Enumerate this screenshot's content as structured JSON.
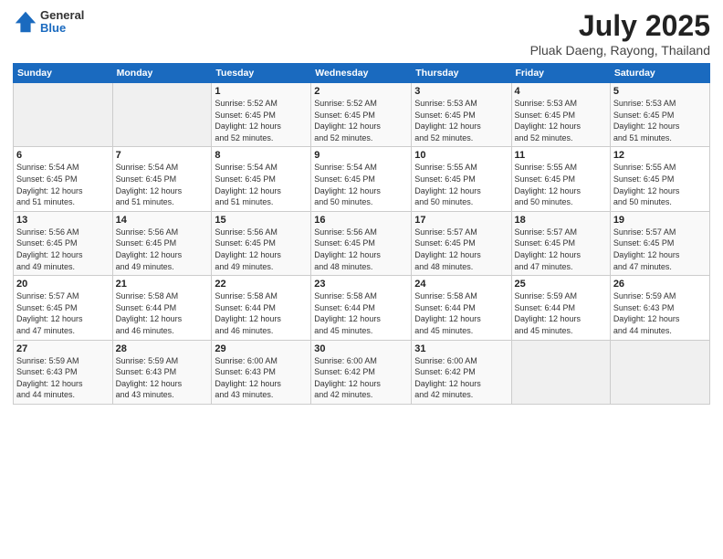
{
  "header": {
    "logo_general": "General",
    "logo_blue": "Blue",
    "title": "July 2025",
    "subtitle": "Pluak Daeng, Rayong, Thailand"
  },
  "weekdays": [
    "Sunday",
    "Monday",
    "Tuesday",
    "Wednesday",
    "Thursday",
    "Friday",
    "Saturday"
  ],
  "weeks": [
    [
      {
        "day": "",
        "info": ""
      },
      {
        "day": "",
        "info": ""
      },
      {
        "day": "1",
        "info": "Sunrise: 5:52 AM\nSunset: 6:45 PM\nDaylight: 12 hours\nand 52 minutes."
      },
      {
        "day": "2",
        "info": "Sunrise: 5:52 AM\nSunset: 6:45 PM\nDaylight: 12 hours\nand 52 minutes."
      },
      {
        "day": "3",
        "info": "Sunrise: 5:53 AM\nSunset: 6:45 PM\nDaylight: 12 hours\nand 52 minutes."
      },
      {
        "day": "4",
        "info": "Sunrise: 5:53 AM\nSunset: 6:45 PM\nDaylight: 12 hours\nand 52 minutes."
      },
      {
        "day": "5",
        "info": "Sunrise: 5:53 AM\nSunset: 6:45 PM\nDaylight: 12 hours\nand 51 minutes."
      }
    ],
    [
      {
        "day": "6",
        "info": "Sunrise: 5:54 AM\nSunset: 6:45 PM\nDaylight: 12 hours\nand 51 minutes."
      },
      {
        "day": "7",
        "info": "Sunrise: 5:54 AM\nSunset: 6:45 PM\nDaylight: 12 hours\nand 51 minutes."
      },
      {
        "day": "8",
        "info": "Sunrise: 5:54 AM\nSunset: 6:45 PM\nDaylight: 12 hours\nand 51 minutes."
      },
      {
        "day": "9",
        "info": "Sunrise: 5:54 AM\nSunset: 6:45 PM\nDaylight: 12 hours\nand 50 minutes."
      },
      {
        "day": "10",
        "info": "Sunrise: 5:55 AM\nSunset: 6:45 PM\nDaylight: 12 hours\nand 50 minutes."
      },
      {
        "day": "11",
        "info": "Sunrise: 5:55 AM\nSunset: 6:45 PM\nDaylight: 12 hours\nand 50 minutes."
      },
      {
        "day": "12",
        "info": "Sunrise: 5:55 AM\nSunset: 6:45 PM\nDaylight: 12 hours\nand 50 minutes."
      }
    ],
    [
      {
        "day": "13",
        "info": "Sunrise: 5:56 AM\nSunset: 6:45 PM\nDaylight: 12 hours\nand 49 minutes."
      },
      {
        "day": "14",
        "info": "Sunrise: 5:56 AM\nSunset: 6:45 PM\nDaylight: 12 hours\nand 49 minutes."
      },
      {
        "day": "15",
        "info": "Sunrise: 5:56 AM\nSunset: 6:45 PM\nDaylight: 12 hours\nand 49 minutes."
      },
      {
        "day": "16",
        "info": "Sunrise: 5:56 AM\nSunset: 6:45 PM\nDaylight: 12 hours\nand 48 minutes."
      },
      {
        "day": "17",
        "info": "Sunrise: 5:57 AM\nSunset: 6:45 PM\nDaylight: 12 hours\nand 48 minutes."
      },
      {
        "day": "18",
        "info": "Sunrise: 5:57 AM\nSunset: 6:45 PM\nDaylight: 12 hours\nand 47 minutes."
      },
      {
        "day": "19",
        "info": "Sunrise: 5:57 AM\nSunset: 6:45 PM\nDaylight: 12 hours\nand 47 minutes."
      }
    ],
    [
      {
        "day": "20",
        "info": "Sunrise: 5:57 AM\nSunset: 6:45 PM\nDaylight: 12 hours\nand 47 minutes."
      },
      {
        "day": "21",
        "info": "Sunrise: 5:58 AM\nSunset: 6:44 PM\nDaylight: 12 hours\nand 46 minutes."
      },
      {
        "day": "22",
        "info": "Sunrise: 5:58 AM\nSunset: 6:44 PM\nDaylight: 12 hours\nand 46 minutes."
      },
      {
        "day": "23",
        "info": "Sunrise: 5:58 AM\nSunset: 6:44 PM\nDaylight: 12 hours\nand 45 minutes."
      },
      {
        "day": "24",
        "info": "Sunrise: 5:58 AM\nSunset: 6:44 PM\nDaylight: 12 hours\nand 45 minutes."
      },
      {
        "day": "25",
        "info": "Sunrise: 5:59 AM\nSunset: 6:44 PM\nDaylight: 12 hours\nand 45 minutes."
      },
      {
        "day": "26",
        "info": "Sunrise: 5:59 AM\nSunset: 6:43 PM\nDaylight: 12 hours\nand 44 minutes."
      }
    ],
    [
      {
        "day": "27",
        "info": "Sunrise: 5:59 AM\nSunset: 6:43 PM\nDaylight: 12 hours\nand 44 minutes."
      },
      {
        "day": "28",
        "info": "Sunrise: 5:59 AM\nSunset: 6:43 PM\nDaylight: 12 hours\nand 43 minutes."
      },
      {
        "day": "29",
        "info": "Sunrise: 6:00 AM\nSunset: 6:43 PM\nDaylight: 12 hours\nand 43 minutes."
      },
      {
        "day": "30",
        "info": "Sunrise: 6:00 AM\nSunset: 6:42 PM\nDaylight: 12 hours\nand 42 minutes."
      },
      {
        "day": "31",
        "info": "Sunrise: 6:00 AM\nSunset: 6:42 PM\nDaylight: 12 hours\nand 42 minutes."
      },
      {
        "day": "",
        "info": ""
      },
      {
        "day": "",
        "info": ""
      }
    ]
  ]
}
